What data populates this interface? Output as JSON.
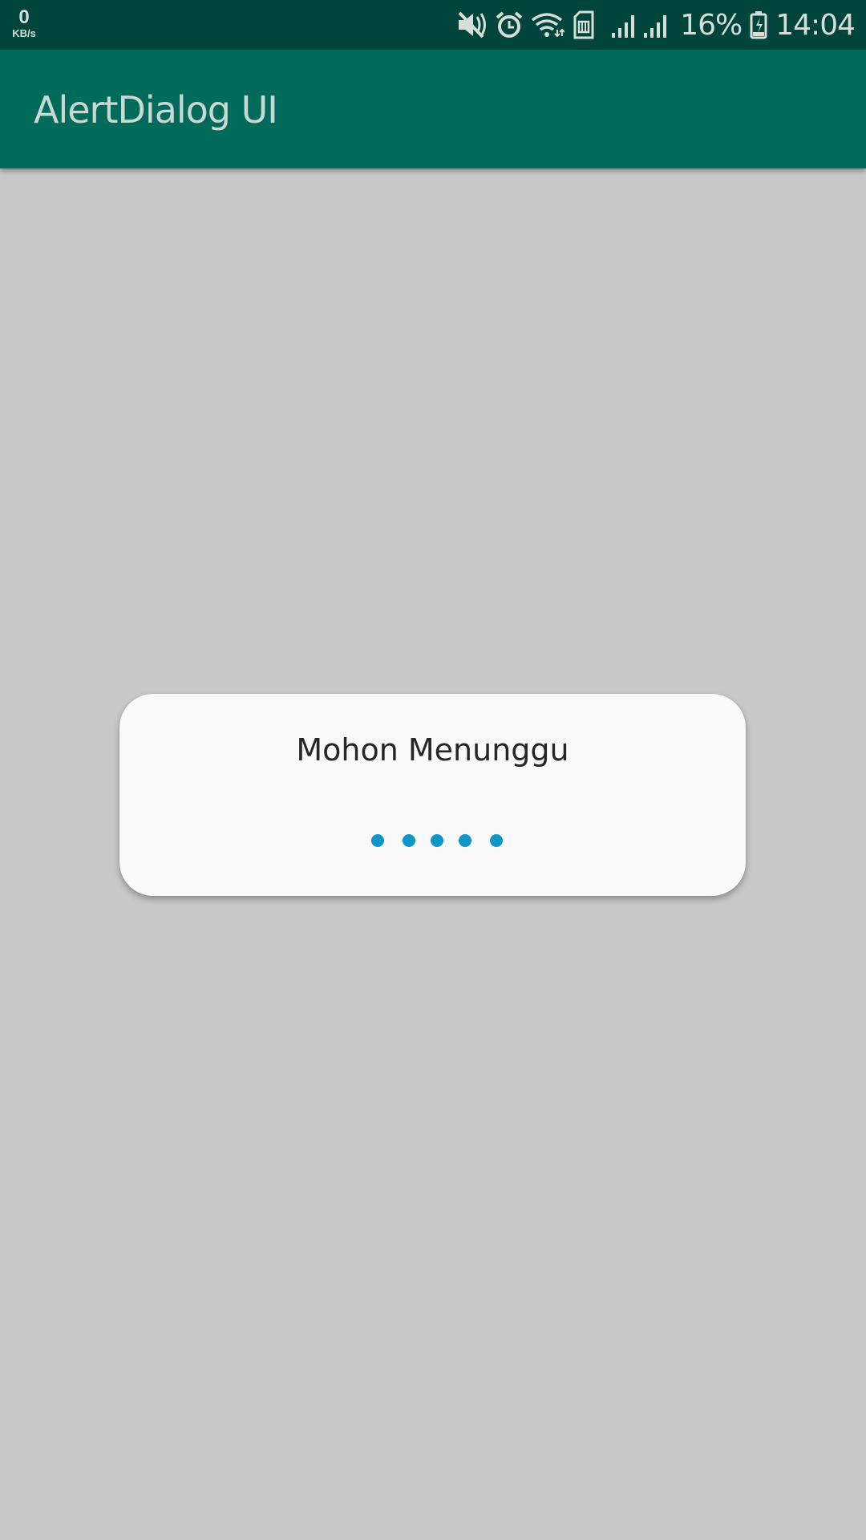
{
  "status_bar": {
    "net_speed_value": "0",
    "net_speed_unit": "KB/s",
    "icons": [
      "mute-icon",
      "alarm-icon",
      "wifi-icon",
      "sim-icon",
      "signal-icon",
      "signal-icon",
      "battery-charging-icon"
    ],
    "battery_percent": "16%",
    "time": "14:04"
  },
  "app_bar": {
    "title": "AlertDialog UI"
  },
  "dialog": {
    "title": "Mohon Menunggu",
    "loading_dots": 5
  },
  "colors": {
    "status_bar": "#00453c",
    "app_bar": "#006a5b",
    "background_dim": "#c8c8c8",
    "dialog_background": "#f9f9f9",
    "dot": "#0e97c6"
  }
}
